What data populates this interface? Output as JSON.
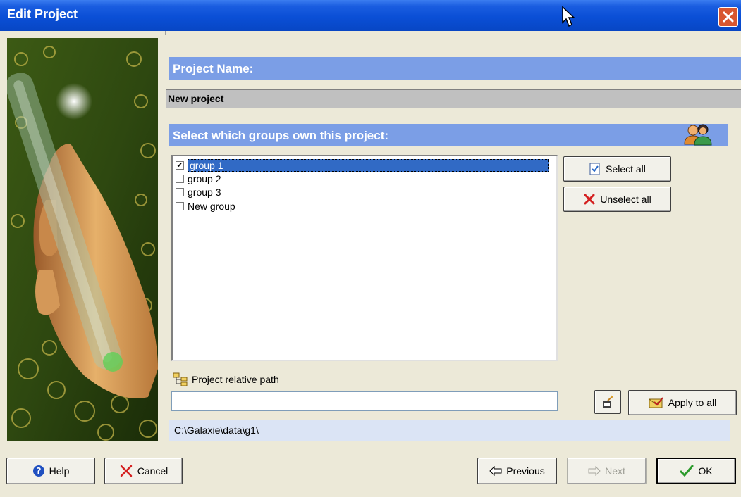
{
  "window": {
    "title": "Edit Project"
  },
  "project_name": {
    "label": "Project Name:",
    "value": "New project"
  },
  "groups": {
    "label": "Select which groups own this project:",
    "items": [
      {
        "label": "group 1",
        "checked": true
      },
      {
        "label": "group 2",
        "checked": false
      },
      {
        "label": "group 3",
        "checked": false
      },
      {
        "label": "New group",
        "checked": false
      }
    ],
    "select_all": "Select all",
    "unselect_all": "Unselect all"
  },
  "path": {
    "label": "Project relative path",
    "value": "",
    "apply_to_all": "Apply to all",
    "resolved": "C:\\Galaxie\\data\\g1\\"
  },
  "footer": {
    "help": "Help",
    "cancel": "Cancel",
    "previous": "Previous",
    "next": "Next",
    "ok": "OK"
  },
  "colors": {
    "title_bar": "#0a4fd6",
    "section_bar": "#7b9ee6",
    "selection": "#316ac5",
    "path_display_bg": "#dbe4f5"
  }
}
